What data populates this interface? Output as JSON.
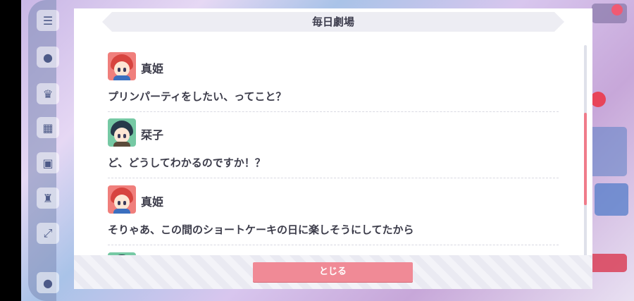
{
  "dialog": {
    "title": "毎日劇場",
    "close_label": "とじる"
  },
  "entries": [
    {
      "name": "真姫",
      "line": "プリンパーティをしたい、ってこと？",
      "avatar_bg": "#f07f7c",
      "hair": "#d7443f",
      "body": "#3b6fbf"
    },
    {
      "name": "栞子",
      "line": "ど、どうしてわかるのですか！？",
      "avatar_bg": "#76c9a4",
      "hair": "#27394a",
      "body": "#5a4a3a"
    },
    {
      "name": "真姫",
      "line": "そりゃあ、この間のショートケーキの日に楽しそうにしてたから",
      "avatar_bg": "#f07f7c",
      "hair": "#d7443f",
      "body": "#3b6fbf"
    }
  ],
  "next_avatar": {
    "avatar_bg": "#76c9a4",
    "hair": "#27394a"
  },
  "colors": {
    "accent": "#f08a96",
    "scroll_thumb": "#f07b8a",
    "text": "#3c3c4a"
  },
  "scroll": {
    "position_fraction": 0.55,
    "visible_fraction": 0.43
  },
  "icons": [
    "menu-icon",
    "chat-icon",
    "present-icon",
    "gift-icon",
    "monitor-icon",
    "trophy-icon",
    "expand-icon",
    "profile-icon"
  ]
}
